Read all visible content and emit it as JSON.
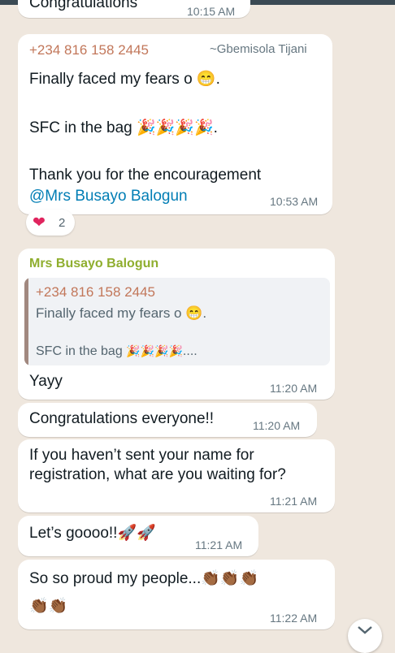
{
  "messages": [
    {
      "text_partial": "Congratulations",
      "time": "10:15 AM"
    },
    {
      "phone": "+234 816 158 2445",
      "contact_name": "~Gbemisola Tijani",
      "line1": "Finally faced my fears o",
      "line1_emoji": "😁",
      "line1_end": ".",
      "line2": "SFC in the bag",
      "line2_emoji": "🎉🎉🎉🎉",
      "line2_end": ".",
      "line3": "Thank you for the encouragement",
      "mention": "@Mrs Busayo Balogun",
      "time": "10:53 AM",
      "reaction_emoji": "❤",
      "reaction_count": "2"
    },
    {
      "sender": "Mrs Busayo Balogun",
      "quoted_phone": "+234 816 158 2445",
      "quoted_line1": "Finally faced my fears o",
      "quoted_line1_emoji": "😁",
      "quoted_line1_end": ".",
      "quoted_line2": "SFC in the bag",
      "quoted_line2_emoji": "🎉🎉🎉🎉",
      "quoted_line2_end": "....",
      "text": "Yayy",
      "time": "11:20 AM"
    },
    {
      "text": "Congratulations everyone!!",
      "time": "11:20 AM"
    },
    {
      "line1": "If you haven’t sent your name for",
      "line2": "registration, what are you waiting for?",
      "time": "11:21 AM"
    },
    {
      "text": "Let’s goooo!!",
      "emoji": "🚀🚀",
      "time": "11:21 AM"
    },
    {
      "text": "So so proud my people...",
      "emoji1": "👏🏾👏🏾👏🏾",
      "emoji2": "👏🏾👏🏾",
      "time": "11:22 AM"
    }
  ],
  "colors": {
    "background": "#efe7de",
    "bubble": "#ffffff",
    "phone_name": "#c2775a",
    "sender_name": "#8fae2e",
    "mention": "#027eb5",
    "time": "#667781"
  },
  "scroll_button_icon": "chevron-down-double-icon"
}
